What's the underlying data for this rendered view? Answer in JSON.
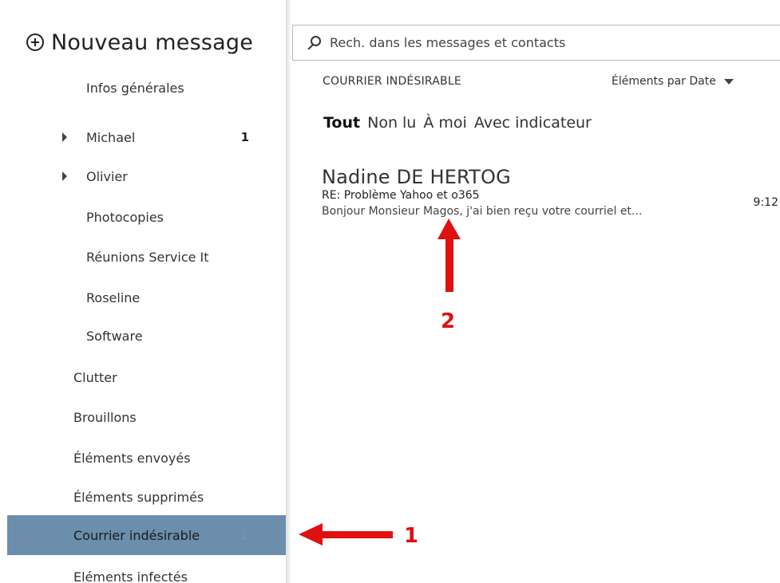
{
  "compose": {
    "label": "Nouveau message"
  },
  "folders": [
    {
      "label": "Infos générales",
      "count": "",
      "expandable": false
    },
    {
      "label": "Michael",
      "count": "1",
      "expandable": true
    },
    {
      "label": "Olivier",
      "count": "",
      "expandable": true
    },
    {
      "label": "Photocopies",
      "count": "",
      "expandable": false
    },
    {
      "label": "Réunions Service It",
      "count": "",
      "expandable": false
    },
    {
      "label": "Roseline",
      "count": "",
      "expandable": false
    },
    {
      "label": "Software",
      "count": "",
      "expandable": false
    },
    {
      "label": "Clutter",
      "count": "",
      "expandable": false
    },
    {
      "label": "Brouillons",
      "count": "",
      "expandable": false
    },
    {
      "label": "Éléments envoyés",
      "count": "",
      "expandable": false
    },
    {
      "label": "Éléments supprimés",
      "count": "",
      "expandable": false
    },
    {
      "label": "Courrier indésirable",
      "count": "1",
      "expandable": false,
      "selected": true
    },
    {
      "label": "Eléments infectés",
      "count": "",
      "expandable": false
    }
  ],
  "search": {
    "placeholder": "Rech. dans les messages et contacts"
  },
  "list": {
    "folder_title": "COURRIER INDÉSIRABLE",
    "sort_label": "Éléments par Date",
    "filters": [
      "Tout",
      "Non lu",
      "À moi",
      "Avec indicateur"
    ],
    "active_filter": "Tout",
    "messages": [
      {
        "sender": "Nadine DE HERTOG",
        "subject": "RE: Problème Yahoo et o365",
        "time": "9:12",
        "preview": "Bonjour Monsieur Magos, j'ai bien reçu votre courriel et..."
      }
    ]
  },
  "annotations": {
    "arrow1_label": "1",
    "arrow2_label": "2",
    "color": "#e01010"
  },
  "colors": {
    "selected_bg": "#6b8ead",
    "accent": "#e01010"
  }
}
